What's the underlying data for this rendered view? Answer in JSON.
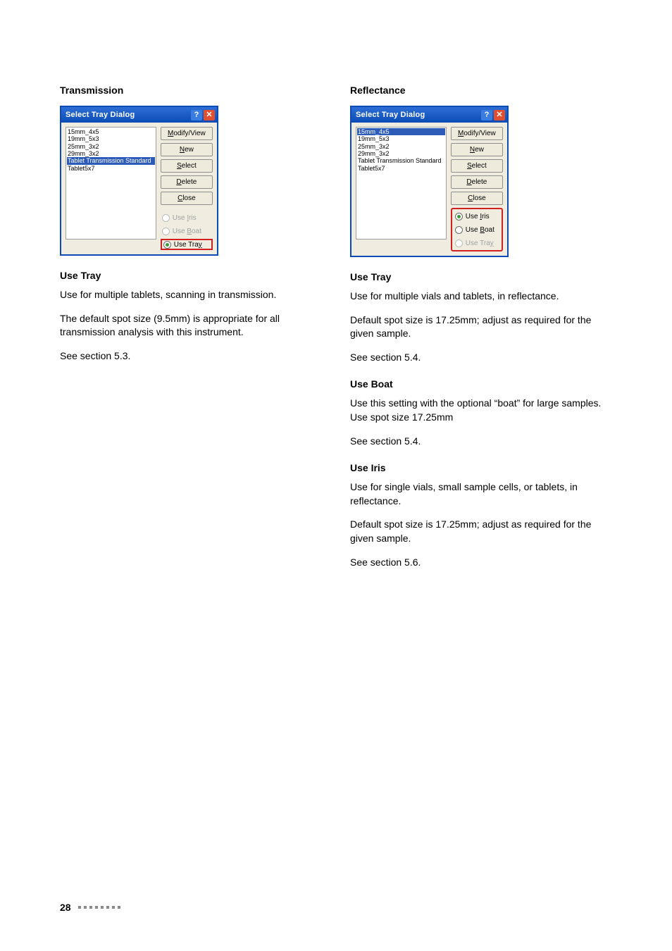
{
  "left": {
    "heading": "Transmission",
    "dialog": {
      "title": "Select Tray Dialog",
      "items": {
        "i0": "15mm_4x5",
        "i1": "19mm_5x3",
        "i2": "25mm_3x2",
        "i3": "29mm_3x2",
        "i4": "Tablet Transmission Standard",
        "i5": "Tablet5x7"
      },
      "buttons": {
        "modify_pre": "M",
        "modify_rest": "odify/View",
        "new_pre": "N",
        "new_rest": "ew",
        "select_pre": "S",
        "select_rest": "elect",
        "delete_pre": "D",
        "delete_rest": "elete",
        "close_pre": "C",
        "close_rest": "lose"
      },
      "radios": {
        "iris_plain": "Use ",
        "iris_pre": "I",
        "iris_rest": "ris",
        "boat_plain": "Use ",
        "boat_pre": "B",
        "boat_rest": "oat",
        "tray_plain": "Use Tra",
        "tray_pre": "y",
        "tray_rest": ""
      }
    },
    "sub1": "Use Tray",
    "p1": "Use for multiple tablets, scanning in transmission.",
    "p2": "The default spot size (9.5mm) is appropriate for all transmission analysis with this instrument.",
    "p3": "See section 5.3."
  },
  "right": {
    "heading": "Reflectance",
    "dialog": {
      "title": "Select Tray Dialog",
      "items": {
        "i0": "15mm_4x5",
        "i1": "19mm_5x3",
        "i2": "25mm_3x2",
        "i3": "29mm_3x2",
        "i4": "Tablet Transmission Standard",
        "i5": "Tablet5x7"
      },
      "buttons": {
        "modify_pre": "M",
        "modify_rest": "odify/View",
        "new_pre": "N",
        "new_rest": "ew",
        "select_pre": "S",
        "select_rest": "elect",
        "delete_pre": "D",
        "delete_rest": "elete",
        "close_pre": "C",
        "close_rest": "lose"
      },
      "radios": {
        "iris_plain": "Use ",
        "iris_pre": "I",
        "iris_rest": "ris",
        "boat_plain": "Use ",
        "boat_pre": "B",
        "boat_rest": "oat",
        "tray_plain": "Use Tra",
        "tray_pre": "y",
        "tray_rest": ""
      }
    },
    "sub1": "Use Tray",
    "p1": "Use for multiple vials and tablets, in reflectance.",
    "p2": "Default spot size is 17.25mm; adjust as required for the given sample.",
    "p3": "See section 5.4.",
    "sub2": "Use Boat",
    "p4": "Use this setting with the optional “boat” for large samples. Use spot size 17.25mm",
    "p5": "See section 5.4.",
    "sub3": "Use Iris",
    "p6": "Use for single vials, small sample cells, or tablets, in reflectance.",
    "p7": "Default spot size is 17.25mm; adjust as required for the given sample.",
    "p8": "See section 5.6."
  },
  "footer": {
    "page": "28"
  }
}
